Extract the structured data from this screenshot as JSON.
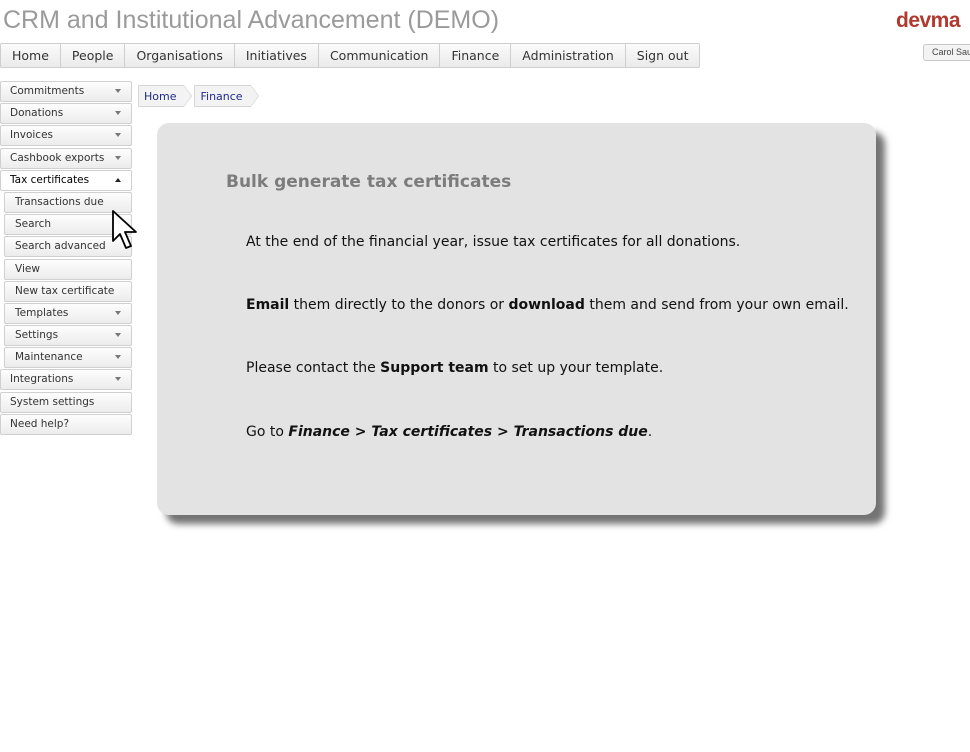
{
  "header": {
    "app_title": "CRM and Institutional Advancement (DEMO)",
    "brand": "devma",
    "user": "Carol Sau"
  },
  "top_nav": [
    "Home",
    "People",
    "Organisations",
    "Initiatives",
    "Communication",
    "Finance",
    "Administration",
    "Sign out"
  ],
  "sidebar": {
    "commitments": "Commitments",
    "donations": "Donations",
    "invoices": "Invoices",
    "cashbook_exports": "Cashbook exports",
    "tax_certificates": "Tax certificates",
    "transactions_due": "Transactions due",
    "search": "Search",
    "search_advanced": "Search advanced",
    "view": "View",
    "new_tax_certificate": "New tax certificate",
    "templates": "Templates",
    "settings": "Settings",
    "maintenance": "Maintenance",
    "integrations": "Integrations",
    "system_settings": "System settings",
    "need_help": "Need help?"
  },
  "breadcrumb": [
    "Home",
    "Finance"
  ],
  "content": {
    "title": "Bulk generate tax certificates",
    "p1": "At the end of the financial year, issue tax certificates for all donations.",
    "p2_email": "Email",
    "p2_mid": " them directly to the donors or ",
    "p2_download": "download",
    "p2_end": " them and send from your own email.",
    "p3_start": "Please contact the ",
    "p3_support": "Support team",
    "p3_end": " to set up your template.",
    "p4_start": "Go to ",
    "p4_path": "Finance > Tax certificates > Transactions due",
    "p4_end": "."
  },
  "icons": {
    "cursor": "mouse-pointer-icon",
    "dropdown": "caret-down-icon"
  },
  "colors": {
    "brand": "#b03a2e",
    "link": "#1e2a8a",
    "card": "#e3e3e3"
  }
}
